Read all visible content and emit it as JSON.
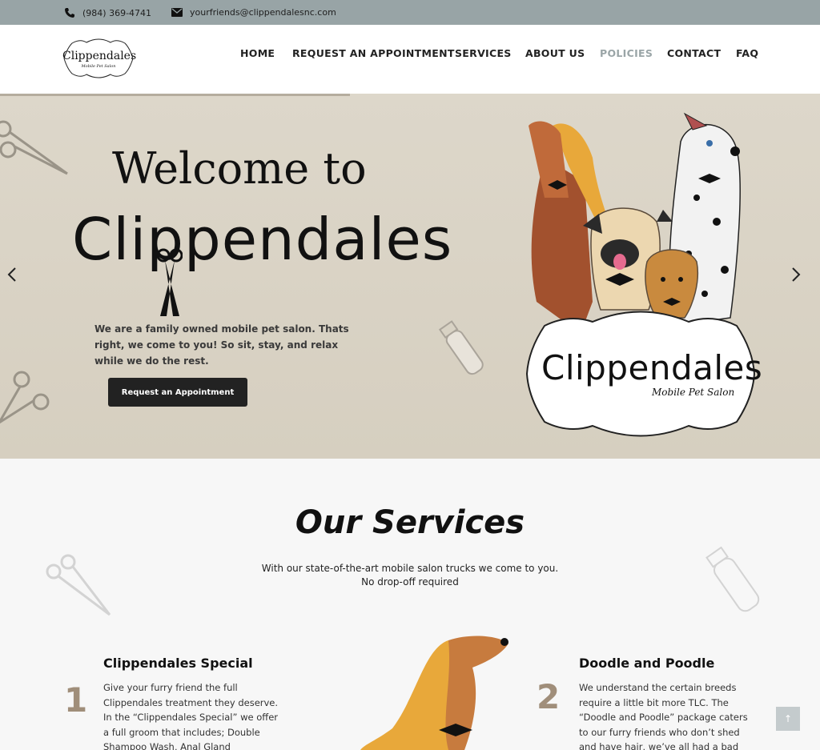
{
  "topbar": {
    "phone": "(984) 369-4741",
    "email": "yourfriends@clippendalesnc.com",
    "icons": [
      "phone-icon",
      "envelope-icon"
    ]
  },
  "header": {
    "logo_text": "Clippendales",
    "logo_sub": "Mobile Pet Salon",
    "nav": [
      {
        "label": "HOME",
        "active": false
      },
      {
        "label": "REQUEST AN APPOINTMENT",
        "active": false
      },
      {
        "label": "SERVICES",
        "active": false
      },
      {
        "label": "ABOUT US",
        "active": false
      },
      {
        "label": "POLICIES",
        "active": true
      },
      {
        "label": "CONTACT",
        "active": false
      },
      {
        "label": "FAQ",
        "active": false
      }
    ]
  },
  "hero": {
    "title_line1": "Welcome to",
    "title_line2": "Clippendales",
    "description": "We are a family owned mobile pet salon. Thats right, we come to you! So sit, stay, and relax while we do the rest.",
    "button_label": "Request an Appointment",
    "badge_title": "Clippendales",
    "badge_sub": "Mobile Pet Salon",
    "colors": {
      "background": "#d9d2c4",
      "button": "#222222"
    }
  },
  "services": {
    "title": "Our Services",
    "subtitle": "With our state-of-the-art mobile salon trucks we come to you. No drop-off required",
    "items": [
      {
        "number": "1",
        "title": "Clippendales Special",
        "text": "Give your furry friend the full Clippendales treatment they deserve. In the “Clippendales Special” we offer a full groom that includes; Double Shampoo Wash, Anal Gland Expression, Ear Cleaning, Ear"
      },
      {
        "number": "2",
        "title": "Doodle and Poodle",
        "text": "We understand the certain breeds require a little bit more TLC. The “Doodle and Poodle” package caters to our furry friends who don’t shed and have hair, we’ve all had a bad hair day right? Click below to"
      }
    ]
  },
  "accent_color": "#a08e7a",
  "scroll_top_label": "↑"
}
